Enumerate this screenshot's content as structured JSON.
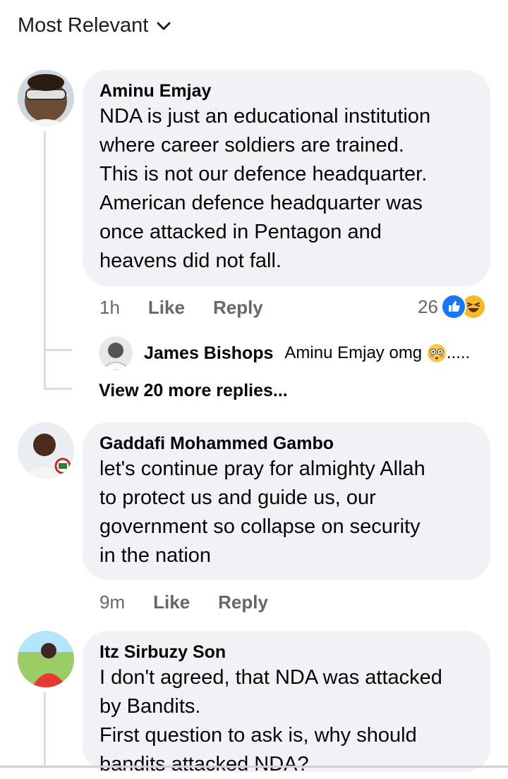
{
  "sort": {
    "label": "Most Relevant"
  },
  "comments": [
    {
      "author": "Aminu Emjay",
      "lines": [
        "NDA is just an educational institution",
        "where career soldiers are trained.",
        "This is not our defence headquarter.",
        "American defence headquarter was",
        "once attacked in Pentagon and",
        "heavens did not fall."
      ],
      "time": "1h",
      "like": "Like",
      "reply": "Reply",
      "reaction_count": "26",
      "reaction_icons": [
        "like-icon",
        "haha-icon"
      ],
      "replies_preview": {
        "author": "James Bishops",
        "text": "Aminu Emjay omg",
        "suffix": ".....",
        "emoji": "flushed-face-emoji"
      },
      "view_more": "View 20 more replies..."
    },
    {
      "author": "Gaddafi Mohammed Gambo",
      "lines": [
        "let's continue pray for almighty Allah",
        "to protect us and guide us, our",
        "government so collapse on security",
        "in the nation"
      ],
      "time": "9m",
      "like": "Like",
      "reply": "Reply"
    },
    {
      "author": "Itz Sirbuzy Son",
      "lines": [
        "I don't agreed, that NDA was attacked",
        "by Bandits.",
        "First question to ask is, why should",
        "bandits attacked NDA?"
      ]
    }
  ],
  "colors": {
    "bubble": "#f0f2f5",
    "secondary_text": "#65676b",
    "like_blue": "#1877f2",
    "haha_yellow": "#f7b928"
  }
}
